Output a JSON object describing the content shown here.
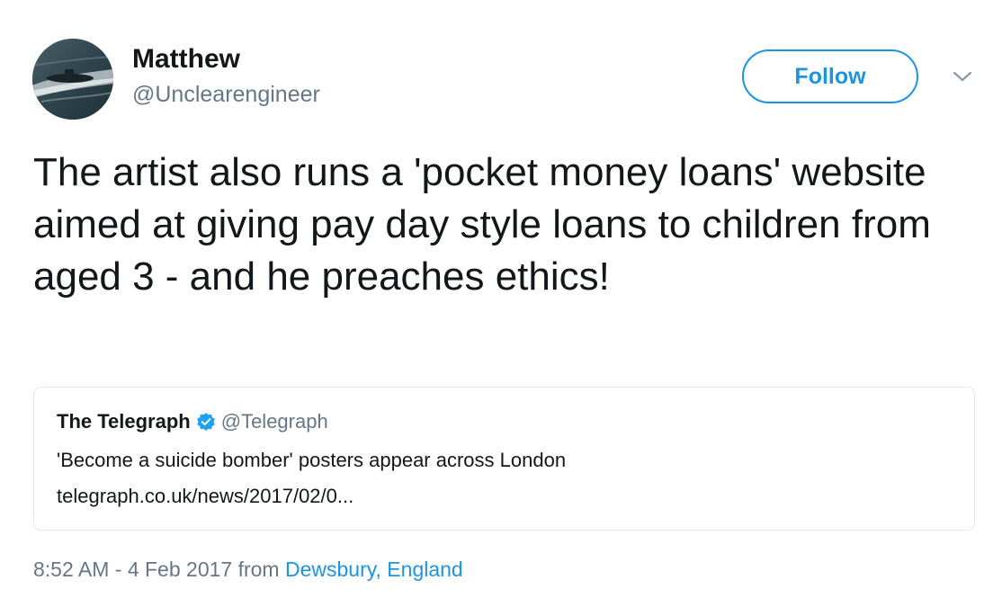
{
  "author": {
    "display_name": "Matthew",
    "handle": "@Unclearengineer",
    "avatar_icon": "submarine-avatar"
  },
  "follow_button": {
    "label": "Follow"
  },
  "menu": {
    "icon": "chevron-down-icon"
  },
  "tweet": {
    "text": "The artist also runs a 'pocket money loans' website aimed at giving pay day style loans to children from aged 3 - and he preaches ethics!"
  },
  "quoted_tweet": {
    "name": "The Telegraph",
    "verified_icon": "verified-badge-icon",
    "handle": "@Telegraph",
    "text": "'Become a suicide bomber' posters appear across London",
    "link": "telegraph.co.uk/news/2017/02/0..."
  },
  "meta": {
    "timestamp": "8:52 AM - 4 Feb 2017",
    "from_label": "from",
    "location": "Dewsbury, England"
  },
  "colors": {
    "accent": "#1b95e0",
    "text": "#14171a",
    "secondary": "#657786",
    "border": "#e1e8ed"
  }
}
